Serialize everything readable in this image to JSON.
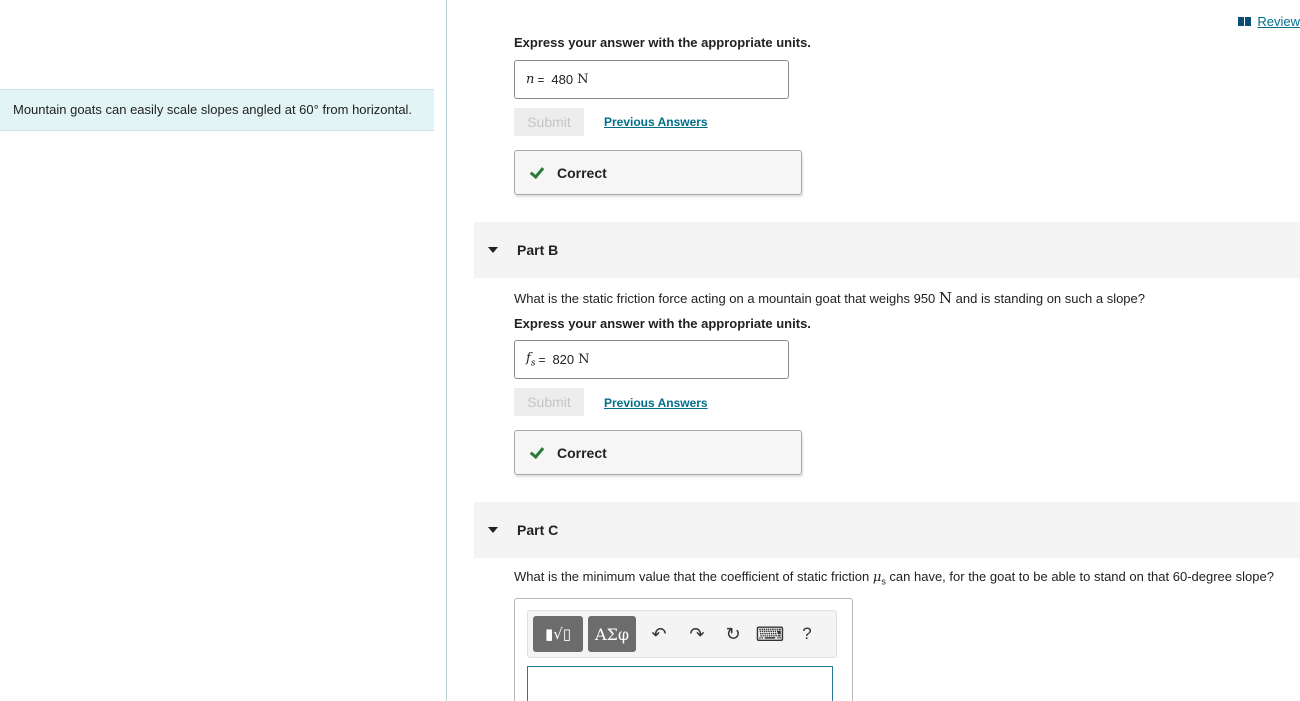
{
  "header": {
    "review_label": "Review"
  },
  "intro": {
    "text_before": "Mountain goats can easily scale slopes angled at 60",
    "degree": "°",
    "text_after": " from horizontal."
  },
  "partA": {
    "units_prompt": "Express your answer with the appropriate units.",
    "var": "n",
    "eq": "=",
    "value": "480",
    "unit": "N",
    "submit_label": "Submit",
    "previous_label": "Previous Answers",
    "result_label": "Correct"
  },
  "partB": {
    "title": "Part B",
    "question_before": "What is the static friction force acting on a mountain goat that weighs 950 ",
    "question_unit": "N",
    "question_after": " and is standing on such a slope?",
    "units_prompt": "Express your answer with the appropriate units.",
    "var": "f",
    "var_sub": "s",
    "eq": "=",
    "value": "820",
    "unit": "N",
    "submit_label": "Submit",
    "previous_label": "Previous Answers",
    "result_label": "Correct"
  },
  "partC": {
    "title": "Part C",
    "question_before": "What is the minimum value that the coefficient of static friction ",
    "var": "μ",
    "var_sub": "s",
    "question_after": " can have, for the goat to be able to stand on that 60-degree slope?",
    "toolbar": {
      "templates_label": "▮√▯",
      "symbols_label": "ΑΣφ",
      "undo_glyph": "↶",
      "redo_glyph": "↷",
      "reset_glyph": "↻",
      "keyboard_glyph": "⌨",
      "help_glyph": "?"
    }
  }
}
